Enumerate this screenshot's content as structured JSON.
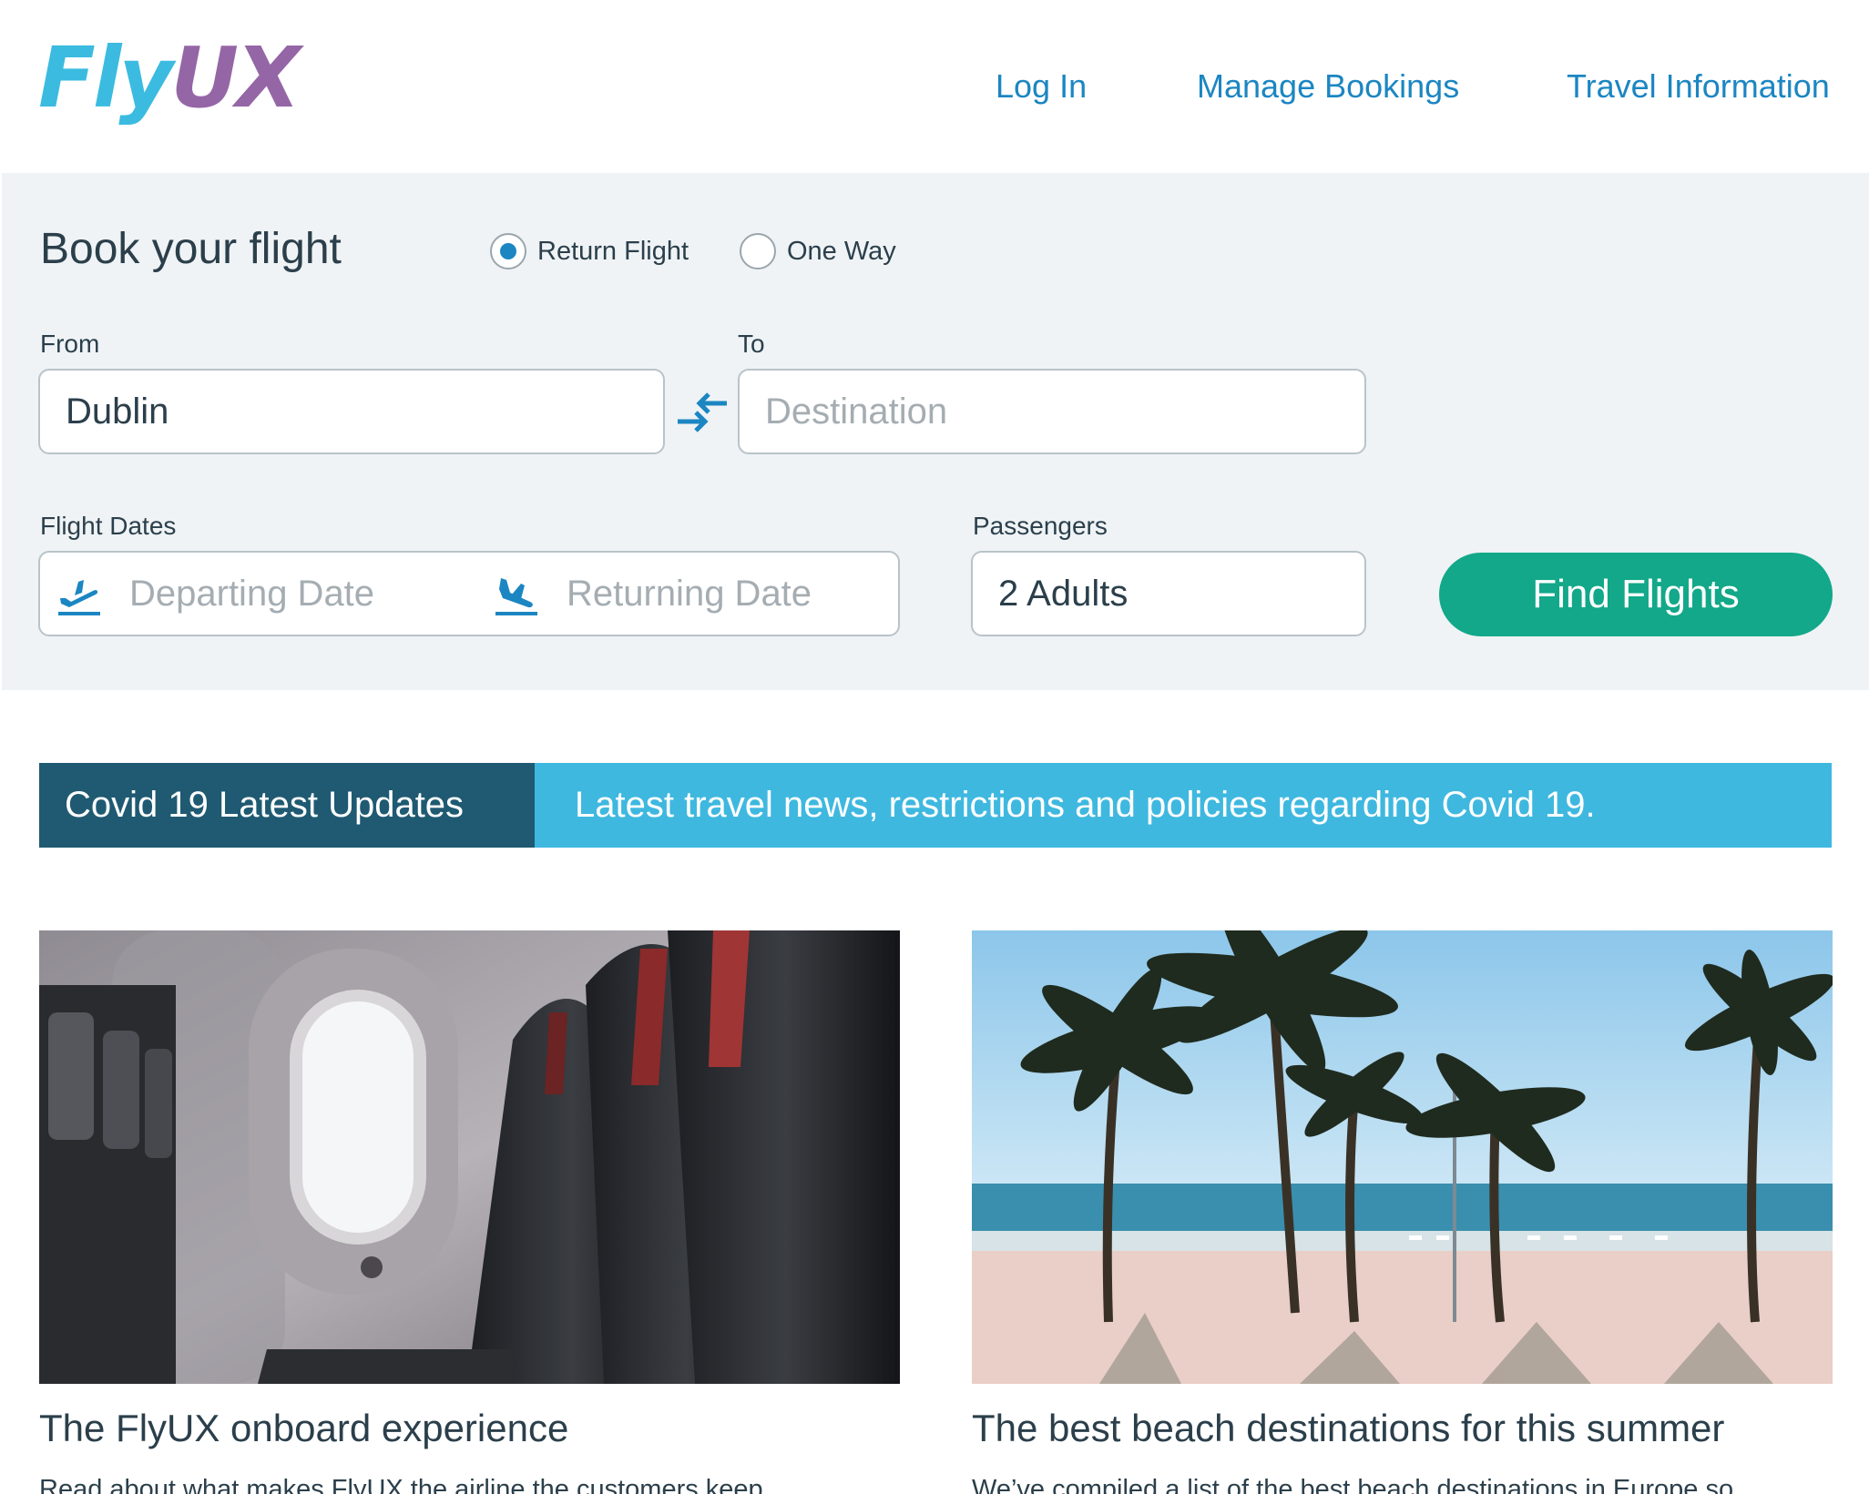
{
  "header": {
    "logo_part1": "Fly",
    "logo_part2": "UX",
    "nav": {
      "login": "Log In",
      "manage": "Manage Bookings",
      "travel": "Travel Information"
    }
  },
  "booking": {
    "title": "Book your flight",
    "trip_type": {
      "return_label": "Return Flight",
      "oneway_label": "One Way",
      "selected": "Return Flight"
    },
    "from": {
      "label": "From",
      "value": "Dublin"
    },
    "to": {
      "label": "To",
      "placeholder": "Destination"
    },
    "dates": {
      "label": "Flight Dates",
      "departing_placeholder": "Departing Date",
      "returning_placeholder": "Returning Date"
    },
    "passengers": {
      "label": "Passengers",
      "value": "2 Adults"
    },
    "find_button": "Find Flights"
  },
  "covid": {
    "label": "Covid 19 Latest Updates",
    "text": "Latest travel news, restrictions and policies regarding Covid 19."
  },
  "articles": [
    {
      "title": "The FlyUX onboard experience",
      "desc": "Read about what makes FlyUX the airline the customers keep"
    },
    {
      "title": "The best beach destinations for this summer",
      "desc": "We’ve compiled a list of the best beach destinations in Europe so"
    }
  ],
  "colors": {
    "brand_blue": "#3bbbe0",
    "brand_purple": "#9566a6",
    "link_blue": "#1b86c2",
    "cta_green": "#12a889",
    "banner_dark": "#1f5a72",
    "banner_light": "#3fb8e0"
  }
}
